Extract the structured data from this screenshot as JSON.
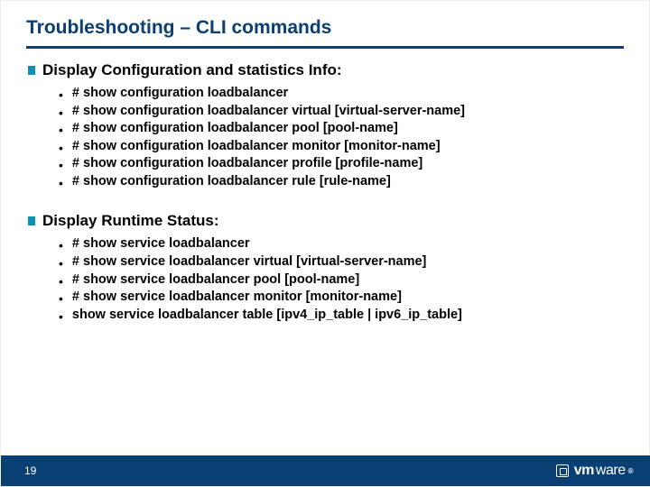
{
  "title": "Troubleshooting – CLI commands",
  "sections": [
    {
      "title": "Display Configuration and statistics Info:",
      "items": [
        "# show configuration loadbalancer",
        "# show configuration loadbalancer virtual [virtual-server-name]",
        "# show configuration loadbalancer pool [pool-name]",
        "# show configuration loadbalancer monitor [monitor-name]",
        "# show configuration loadbalancer profile [profile-name]",
        "# show configuration loadbalancer rule [rule-name]"
      ]
    },
    {
      "title": "Display Runtime Status:",
      "items": [
        "# show service loadbalancer",
        "# show service loadbalancer virtual [virtual-server-name]",
        "# show service loadbalancer pool [pool-name]",
        "# show service loadbalancer monitor [monitor-name]",
        "show service loadbalancer table [ipv4_ip_table | ipv6_ip_table]"
      ]
    }
  ],
  "footer": {
    "page": "19",
    "logo": {
      "vm": "vm",
      "ware": "ware",
      "r": "®"
    }
  }
}
